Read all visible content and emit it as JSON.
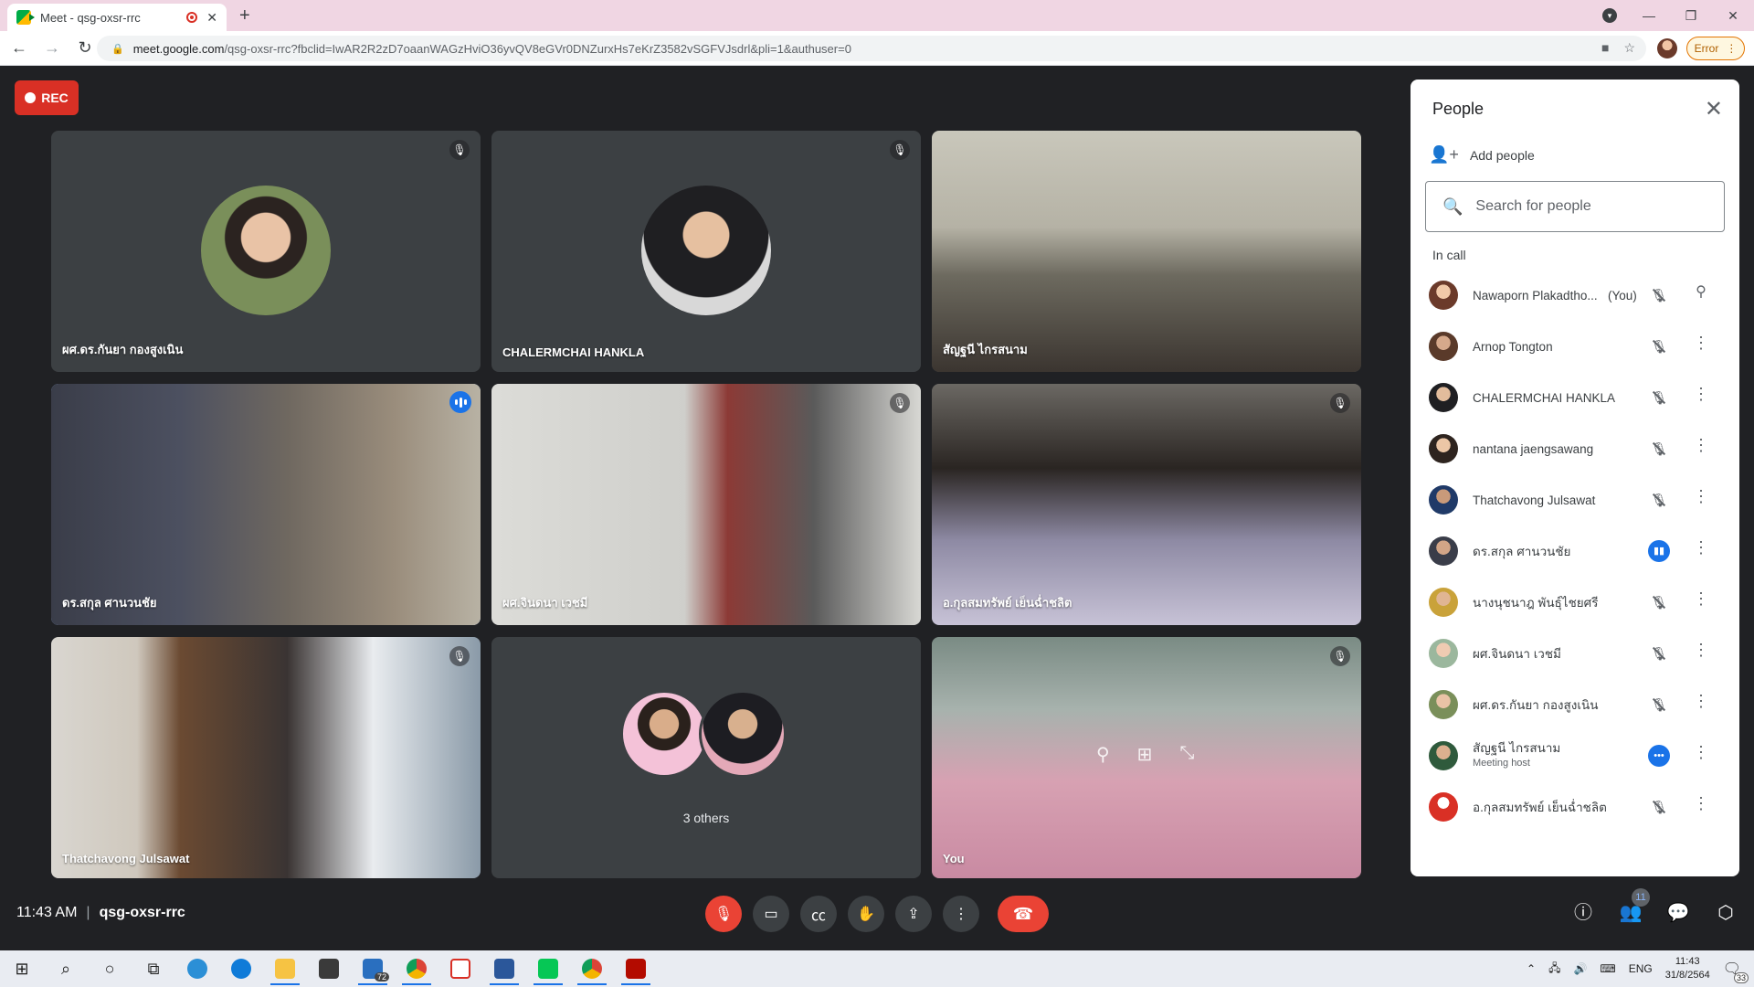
{
  "browser": {
    "tab_title": "Meet - qsg-oxsr-rrc",
    "new_tab": "+",
    "tab_close": "✕",
    "url_host": "meet.google.com",
    "url_rest": "/qsg-oxsr-rrc?fbclid=IwAR2R2zD7oaanWAGzHviO36yvQV8eGVr0DNZurxHs7eKrZ3582vSGFVJsdrl&pli=1&authuser=0",
    "error_label": "Error"
  },
  "meet": {
    "rec_label": "REC",
    "time": "11:43 AM",
    "meeting_code": "qsg-oxsr-rrc",
    "others_label": "3 others",
    "tiles": [
      {
        "name": "ผศ.ดร.กันยา กองสูงเนิน"
      },
      {
        "name": "CHALERMCHAI HANKLA"
      },
      {
        "name": "สัญฐนี ไกรสนาม"
      },
      {
        "name": "ดร.สกุล ศานวนชัย"
      },
      {
        "name": "ผศ.จินดนา เวชมี"
      },
      {
        "name": "อ.กุลสมทรัพย์ เย็นฉ่ำชลิต"
      },
      {
        "name": "Thatchavong Julsawat"
      },
      {
        "name": ""
      },
      {
        "name": "You"
      }
    ],
    "people_badge": "11"
  },
  "panel": {
    "title": "People",
    "add_people": "Add people",
    "search_placeholder": "Search for people",
    "in_call": "In call",
    "participants": [
      {
        "name": "Nawaporn Plakadtho...",
        "you": "(You)",
        "sub": ""
      },
      {
        "name": "Arnop Tongton",
        "sub": ""
      },
      {
        "name": "CHALERMCHAI HANKLA",
        "sub": ""
      },
      {
        "name": "nantana jaengsawang",
        "sub": ""
      },
      {
        "name": "Thatchavong Julsawat",
        "sub": ""
      },
      {
        "name": "ดร.สกุล ศานวนชัย",
        "sub": ""
      },
      {
        "name": "นางนุชนาฎ พันธุ์ไชยศรี",
        "sub": ""
      },
      {
        "name": "ผศ.จินดนา เวชมี",
        "sub": ""
      },
      {
        "name": "ผศ.ดร.กันยา กองสูงเนิน",
        "sub": ""
      },
      {
        "name": "สัญฐนี ไกรสนาม",
        "sub": "Meeting host"
      },
      {
        "name": "อ.กุลสมทรัพย์ เย็นฉ่ำชลิต",
        "sub": ""
      }
    ]
  },
  "taskbar": {
    "mail_count": "72",
    "lang": "ENG",
    "clock_time": "11:43",
    "clock_date": "31/8/2564",
    "notif_count": "33"
  },
  "colors": {
    "stage_bg": "#202124",
    "tile_bg": "#3c4043",
    "accent_blue": "#1a73e8",
    "danger_red": "#ea4335",
    "rec_red": "#d93025",
    "tab_strip": "#f0d6e3"
  }
}
